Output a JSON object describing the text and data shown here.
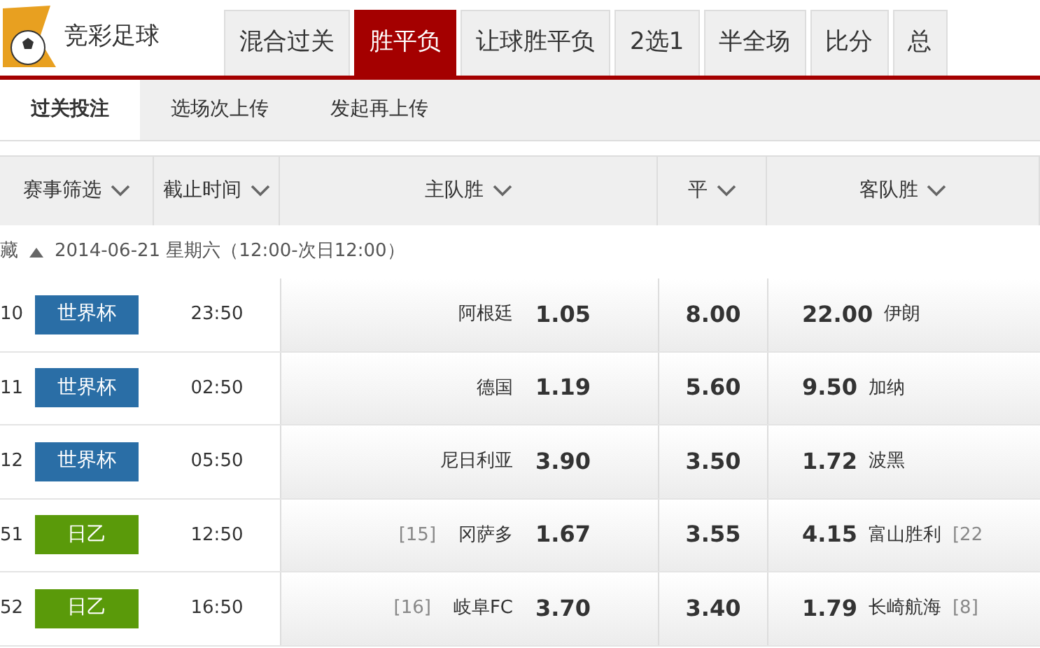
{
  "header": {
    "title": "竞彩足球"
  },
  "tabs": [
    {
      "label": "混合过关",
      "selected": false
    },
    {
      "label": "胜平负",
      "selected": true
    },
    {
      "label": "让球胜平负",
      "selected": false
    },
    {
      "label": "2选1",
      "selected": false
    },
    {
      "label": "半全场",
      "selected": false
    },
    {
      "label": "比分",
      "selected": false
    },
    {
      "label": "总",
      "selected": false
    }
  ],
  "subtabs": [
    {
      "label": "过关投注",
      "selected": true
    },
    {
      "label": "选场次上传",
      "selected": false
    },
    {
      "label": "发起再上传",
      "selected": false
    }
  ],
  "columns": [
    "赛事筛选",
    "截止时间",
    "主队胜",
    "平",
    "客队胜"
  ],
  "date_row": {
    "toggle": "藏",
    "date": "2014-06-21 星期六（12:00-次日12:00）"
  },
  "rows": [
    {
      "num": "10",
      "league": "世界杯",
      "color": "#2a6ea6",
      "time": "23:50",
      "home": "阿根廷",
      "home_odds": "1.05",
      "draw_odds": "8.00",
      "away_odds": "22.00",
      "away": "伊朗"
    },
    {
      "num": "11",
      "league": "世界杯",
      "color": "#2a6ea6",
      "time": "02:50",
      "home": "德国",
      "home_odds": "1.19",
      "draw_odds": "5.60",
      "away_odds": "9.50",
      "away": "加纳"
    },
    {
      "num": "12",
      "league": "世界杯",
      "color": "#2a6ea6",
      "time": "05:50",
      "home": "尼日利亚",
      "home_odds": "3.90",
      "draw_odds": "3.50",
      "away_odds": "1.72",
      "away": "波黑"
    },
    {
      "num": "51",
      "league": "日乙",
      "color": "#5a9a0a",
      "time": "12:50",
      "home_rank": "[15]",
      "home": "冈萨多",
      "home_odds": "1.67",
      "draw_odds": "3.55",
      "away_odds": "4.15",
      "away": "富山胜利",
      "away_rank": "[22"
    },
    {
      "num": "52",
      "league": "日乙",
      "color": "#5a9a0a",
      "time": "16:50",
      "home_rank": "[16]",
      "home": "岐阜FC",
      "home_odds": "3.70",
      "draw_odds": "3.40",
      "away_odds": "1.79",
      "away": "长崎航海",
      "away_rank": "[8]"
    }
  ]
}
